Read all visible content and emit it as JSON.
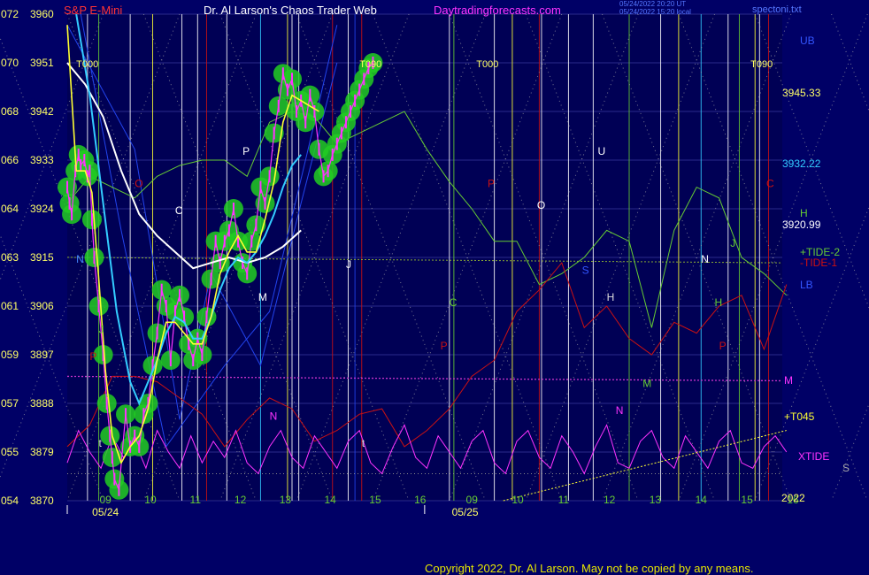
{
  "header": {
    "instrument": "S&P E-Mini",
    "source": "Dr. Al Larson's Chaos Trader Web",
    "site": "Daytradingforecasts.com",
    "timestamp_1": "05/24/2022 20:20 UT",
    "timestamp_2": "05/24/2022 15:20 local",
    "file": "spectoni.txt"
  },
  "copyright": "Copyright 2022, Dr. Al Larson. May not be copied by any means.",
  "colors": {
    "background": "#000066",
    "price_bars": "#ff33ff",
    "fast_avg": "#ffff33",
    "mid_avg": "#33ccff",
    "slow_avg": "#ffffff",
    "shadow": "#22cc22",
    "tide_green": "#66cc33",
    "tide_red": "#cc1111",
    "xtide": "#ff33ff",
    "flux_blue": "#2244ee",
    "grid": "#2a2a8a",
    "level_m": "#cc33cc"
  },
  "chart_data": {
    "type": "line",
    "title": "S&P E-Mini",
    "y_left_outer_ticks": [
      "072",
      "070",
      "068",
      "066",
      "064",
      "063",
      "061",
      "059",
      "057",
      "055",
      "054"
    ],
    "y_left_inner_ticks": [
      "3960",
      "3951",
      "3942",
      "3933",
      "3924",
      "3915",
      "3906",
      "3897",
      "3888",
      "3879",
      "3870"
    ],
    "ylim": [
      3870,
      3960
    ],
    "x_hour_ticks": [
      "09",
      "10",
      "11",
      "12",
      "13",
      "14",
      "15",
      "16",
      "09",
      "10",
      "11",
      "12",
      "13",
      "14",
      "15",
      "16"
    ],
    "x_date_labels": [
      "05/24",
      "05/25"
    ],
    "year_label": "2022",
    "right_levels": [
      {
        "label": "UB",
        "color": "#3355ff"
      },
      {
        "label": "3945.33",
        "value": 3945.33,
        "color": "#ffff66"
      },
      {
        "label": "3932.22",
        "value": 3932.22,
        "color": "#33ccff"
      },
      {
        "label": "H",
        "color": "#66cc33"
      },
      {
        "label": "3920.99",
        "value": 3920.99,
        "color": "#ffffff"
      },
      {
        "label": "+TIDE-2",
        "color": "#66cc33"
      },
      {
        "label": "-TIDE-1",
        "color": "#cc1111"
      },
      {
        "label": "LB",
        "color": "#3355ff"
      },
      {
        "label": "M",
        "color": "#ff33ff"
      },
      {
        "label": "+T045",
        "color": "#ffff33"
      },
      {
        "label": "XTIDE",
        "color": "#ff33ff"
      },
      {
        "label": "S",
        "color": "#aaaaaa"
      }
    ],
    "cycle_labels": [
      "T000",
      "T090",
      "T000",
      "T090"
    ],
    "in_chart_letters": [
      "N",
      "J",
      "P",
      "C",
      "O",
      "P",
      "M",
      "N",
      "J",
      "C",
      "P",
      "P",
      "O",
      "U",
      "S",
      "H",
      "M",
      "N",
      "N",
      "J",
      "P",
      "C",
      "H",
      "t",
      "t"
    ],
    "price_series": {
      "name": "",
      "x": [
        0,
        0.05,
        0.1,
        0.18,
        0.25,
        0.3,
        0.38,
        0.45,
        0.5,
        0.55,
        0.6,
        0.7,
        0.8,
        0.88,
        0.95,
        1.0,
        1.05,
        1.15,
        1.3,
        1.4,
        1.5,
        1.6,
        1.7,
        1.8,
        1.9,
        2.0,
        2.1,
        2.2,
        2.3,
        2.4,
        2.5,
        2.6,
        2.7,
        2.8,
        2.9,
        3.0,
        3.1,
        3.2,
        3.3,
        3.4,
        3.5,
        3.6,
        3.7,
        3.8,
        3.9,
        4.0,
        4.1,
        4.2,
        4.3,
        4.4,
        4.5,
        4.6,
        4.7,
        4.8,
        4.9,
        5.0,
        5.1,
        5.2,
        5.3,
        5.4,
        5.5,
        5.6,
        5.7,
        5.8,
        5.9,
        6.0,
        6.1,
        6.2,
        6.3,
        6.4,
        6.5,
        6.6,
        6.7,
        6.8
      ],
      "values": [
        3928,
        3925,
        3923,
        3931,
        3934,
        3932,
        3933,
        3930,
        3931,
        3922,
        3915,
        3906,
        3897,
        3888,
        3882,
        3878,
        3874,
        3872,
        3886,
        3880,
        3882,
        3880,
        3886,
        3888,
        3895,
        3901,
        3909,
        3906,
        3896,
        3905,
        3908,
        3904,
        3899,
        3896,
        3900,
        3897,
        3904,
        3911,
        3918,
        3914,
        3918,
        3920,
        3924,
        3918,
        3914,
        3912,
        3918,
        3921,
        3928,
        3925,
        3930,
        3938,
        3943,
        3949,
        3946,
        3948,
        3942,
        3944,
        3940,
        3945,
        3942,
        3935,
        3930,
        3931,
        3934,
        3936,
        3938,
        3940,
        3942,
        3944,
        3946,
        3948,
        3950,
        3951
      ]
    },
    "fast_avg": {
      "x": [
        0,
        0.2,
        0.4,
        0.55,
        0.7,
        0.85,
        1.0,
        1.2,
        1.4,
        1.6,
        1.8,
        2.0,
        2.2,
        2.4,
        2.6,
        2.8,
        3.0,
        3.2,
        3.4,
        3.6,
        3.8,
        4.0,
        4.2,
        4.4,
        4.6,
        4.8,
        5.0,
        5.2,
        5.4,
        5.6
      ],
      "values": [
        3958,
        3931,
        3931,
        3927,
        3911,
        3894,
        3882,
        3877,
        3880,
        3882,
        3887,
        3896,
        3903,
        3903,
        3901,
        3899,
        3899,
        3904,
        3912,
        3916,
        3919,
        3916,
        3916,
        3922,
        3929,
        3940,
        3945,
        3944,
        3943,
        3942
      ]
    },
    "mid_avg": {
      "x": [
        0.2,
        0.5,
        0.8,
        1.1,
        1.4,
        1.6,
        1.8,
        2.0,
        2.2,
        2.4,
        2.6,
        2.8,
        3.0,
        3.2,
        3.4,
        3.6,
        3.8,
        4.0,
        4.2,
        4.4,
        4.6,
        4.8,
        5.0,
        5.2
      ],
      "values": [
        3960,
        3945,
        3925,
        3905,
        3892,
        3888,
        3892,
        3896,
        3901,
        3904,
        3903,
        3900,
        3900,
        3904,
        3909,
        3913,
        3915,
        3914,
        3916,
        3919,
        3923,
        3928,
        3932,
        3934
      ]
    },
    "slow_avg": {
      "x": [
        0,
        0.4,
        0.8,
        1.2,
        1.6,
        2.0,
        2.4,
        2.8,
        3.2,
        3.6,
        4.0,
        4.4,
        4.8,
        5.2
      ],
      "values": [
        3951,
        3947,
        3941,
        3931,
        3923,
        3919,
        3916,
        3913,
        3914,
        3915,
        3914,
        3915,
        3917,
        3920
      ]
    },
    "tide_green": {
      "x": [
        0,
        0.5,
        1.0,
        1.5,
        2.0,
        2.5,
        3.0,
        3.5,
        4.0,
        4.5,
        5.0,
        5.5,
        6.0,
        6.5,
        7.0,
        7.5,
        8.0,
        8.5,
        9.0,
        9.5,
        10.0,
        10.5,
        11.0,
        11.5,
        12.0,
        12.5,
        13.0,
        13.5,
        14.0,
        14.5,
        15.0,
        15.5,
        16.0
      ],
      "values": [
        3925,
        3930,
        3928,
        3926,
        3930,
        3932,
        3933,
        3933,
        3930,
        3940,
        3942,
        3941,
        3936,
        3938,
        3940,
        3942,
        3935,
        3929,
        3924,
        3918,
        3918,
        3910,
        3912,
        3915,
        3920,
        3918,
        3902,
        3920,
        3928,
        3926,
        3915,
        3912,
        3908
      ]
    },
    "tide_red": {
      "x": [
        0,
        0.5,
        1.0,
        1.5,
        2.0,
        2.5,
        3.0,
        3.5,
        4.0,
        4.5,
        5.0,
        5.5,
        6.0,
        6.5,
        7.0,
        7.5,
        8.0,
        8.5,
        9.0,
        9.5,
        10.0,
        10.5,
        11.0,
        11.5,
        12.0,
        12.5,
        13.0,
        13.5,
        14.0,
        14.5,
        15.0,
        15.5,
        16.0
      ],
      "values": [
        3880,
        3884,
        3893,
        3893,
        3892,
        3889,
        3886,
        3880,
        3885,
        3889,
        3887,
        3881,
        3883,
        3886,
        3887,
        3880,
        3883,
        3887,
        3893,
        3896,
        3905,
        3909,
        3914,
        3902,
        3906,
        3900,
        3897,
        3903,
        3901,
        3906,
        3908,
        3898,
        3910
      ]
    },
    "xtide": {
      "x": [
        0,
        0.25,
        0.5,
        0.75,
        1.0,
        1.25,
        1.5,
        1.75,
        2.0,
        2.25,
        2.5,
        2.75,
        3.0,
        3.25,
        3.5,
        3.75,
        4.0,
        4.25,
        4.5,
        4.75,
        5.0,
        5.25,
        5.5,
        5.75,
        6.0,
        6.25,
        6.5,
        6.75,
        7.0,
        7.25,
        7.5,
        7.75,
        8.0,
        8.25,
        8.5,
        8.75,
        9.0,
        9.25,
        9.5,
        9.75,
        10.0,
        10.25,
        10.5,
        10.75,
        11.0,
        11.25,
        11.5,
        11.75,
        12.0,
        12.25,
        12.5,
        12.75,
        13.0,
        13.25,
        13.5,
        13.75,
        14.0,
        14.25,
        14.5,
        14.75,
        15.0,
        15.25,
        15.5,
        15.75,
        16.0
      ],
      "values": [
        3877,
        3883,
        3879,
        3876,
        3882,
        3878,
        3881,
        3876,
        3883,
        3879,
        3876,
        3882,
        3877,
        3881,
        3878,
        3883,
        3877,
        3875,
        3880,
        3883,
        3878,
        3876,
        3882,
        3879,
        3876,
        3881,
        3883,
        3877,
        3875,
        3880,
        3884,
        3878,
        3876,
        3882,
        3879,
        3876,
        3881,
        3883,
        3877,
        3875,
        3881,
        3883,
        3878,
        3876,
        3882,
        3879,
        3875,
        3880,
        3884,
        3877,
        3876,
        3881,
        3883,
        3878,
        3876,
        3882,
        3879,
        3876,
        3881,
        3883,
        3877,
        3876,
        3880,
        3882,
        3879
      ]
    },
    "m_level": 3893,
    "t045_line": {
      "x": [
        9.7,
        16.0
      ],
      "values": [
        3870,
        3883
      ]
    },
    "h_level": 3916
  }
}
